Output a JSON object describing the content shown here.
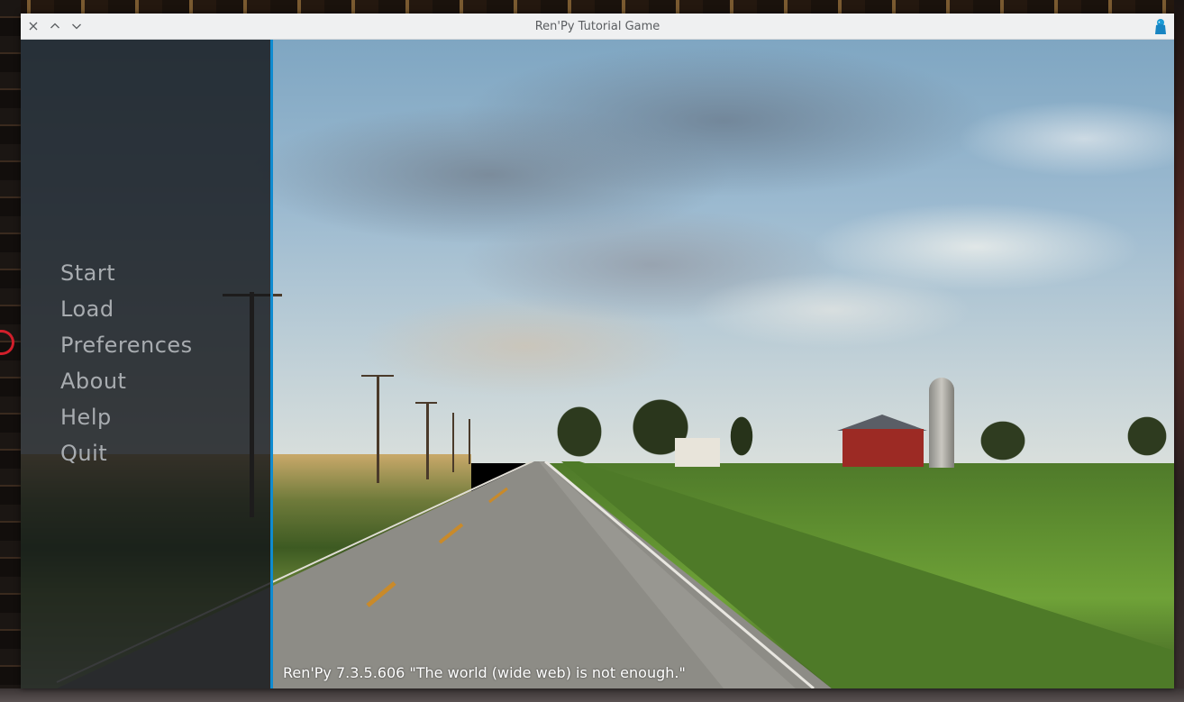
{
  "window": {
    "title": "Ren'Py Tutorial Game",
    "controls": {
      "close_icon": "close-icon",
      "maximize_icon": "chevron-up-icon",
      "minimize_icon": "chevron-down-icon",
      "app_icon": "renpy-app-icon"
    }
  },
  "main_menu": {
    "items": [
      {
        "label": "Start"
      },
      {
        "label": "Load"
      },
      {
        "label": "Preferences"
      },
      {
        "label": "About"
      },
      {
        "label": "Help"
      },
      {
        "label": "Quit"
      }
    ]
  },
  "footer": {
    "version_text": "Ren'Py 7.3.5.606 \"The world (wide web) is not enough.\""
  },
  "colors": {
    "accent": "#0f8bd0",
    "menu_text": "#a8acb0",
    "titlebar_bg": "#eff0f1"
  }
}
